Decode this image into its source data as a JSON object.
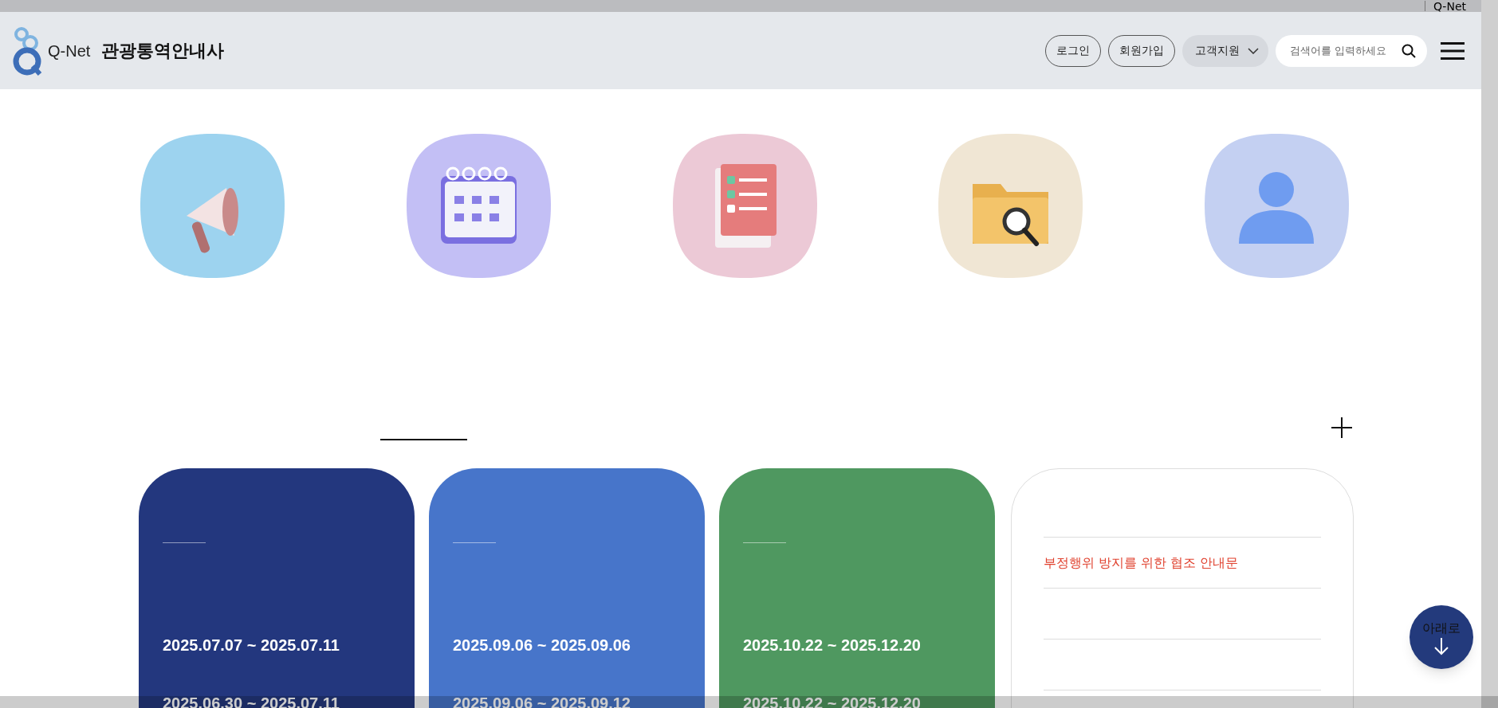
{
  "top_bar": {
    "link": "Q-Net"
  },
  "header": {
    "logo_text": "Q-Net",
    "site_title": "관광통역안내사",
    "buttons": [
      {
        "label": "로그인",
        "kind": "outline"
      },
      {
        "label": "회원가입",
        "kind": "outline"
      },
      {
        "label": "고객지원",
        "kind": "dropdown"
      }
    ],
    "search": {
      "placeholder": "검색어를 입력하세요"
    }
  },
  "quick_links": [
    {
      "kind": "megaphone"
    },
    {
      "kind": "calendar"
    },
    {
      "kind": "checklist"
    },
    {
      "kind": "folder"
    },
    {
      "kind": "user"
    }
  ],
  "schedule_cards": [
    {
      "color": "#23377e",
      "dates": [
        "2025.07.07 ~ 2025.07.11",
        "2025.06.30 ~ 2025.07.11"
      ]
    },
    {
      "color": "#4775ca",
      "dates": [
        "2025.09.06 ~ 2025.09.06",
        "2025.09.06 ~ 2025.09.12"
      ]
    },
    {
      "color": "#4f9860",
      "dates": [
        "2025.10.22 ~ 2025.12.20",
        "2025.10.22 ~ 2025.12.20"
      ]
    }
  ],
  "notices": [
    {
      "title": "부정행위 방지를 위한 협조 안내문"
    }
  ],
  "scroll_button": {
    "label": "아래로"
  }
}
